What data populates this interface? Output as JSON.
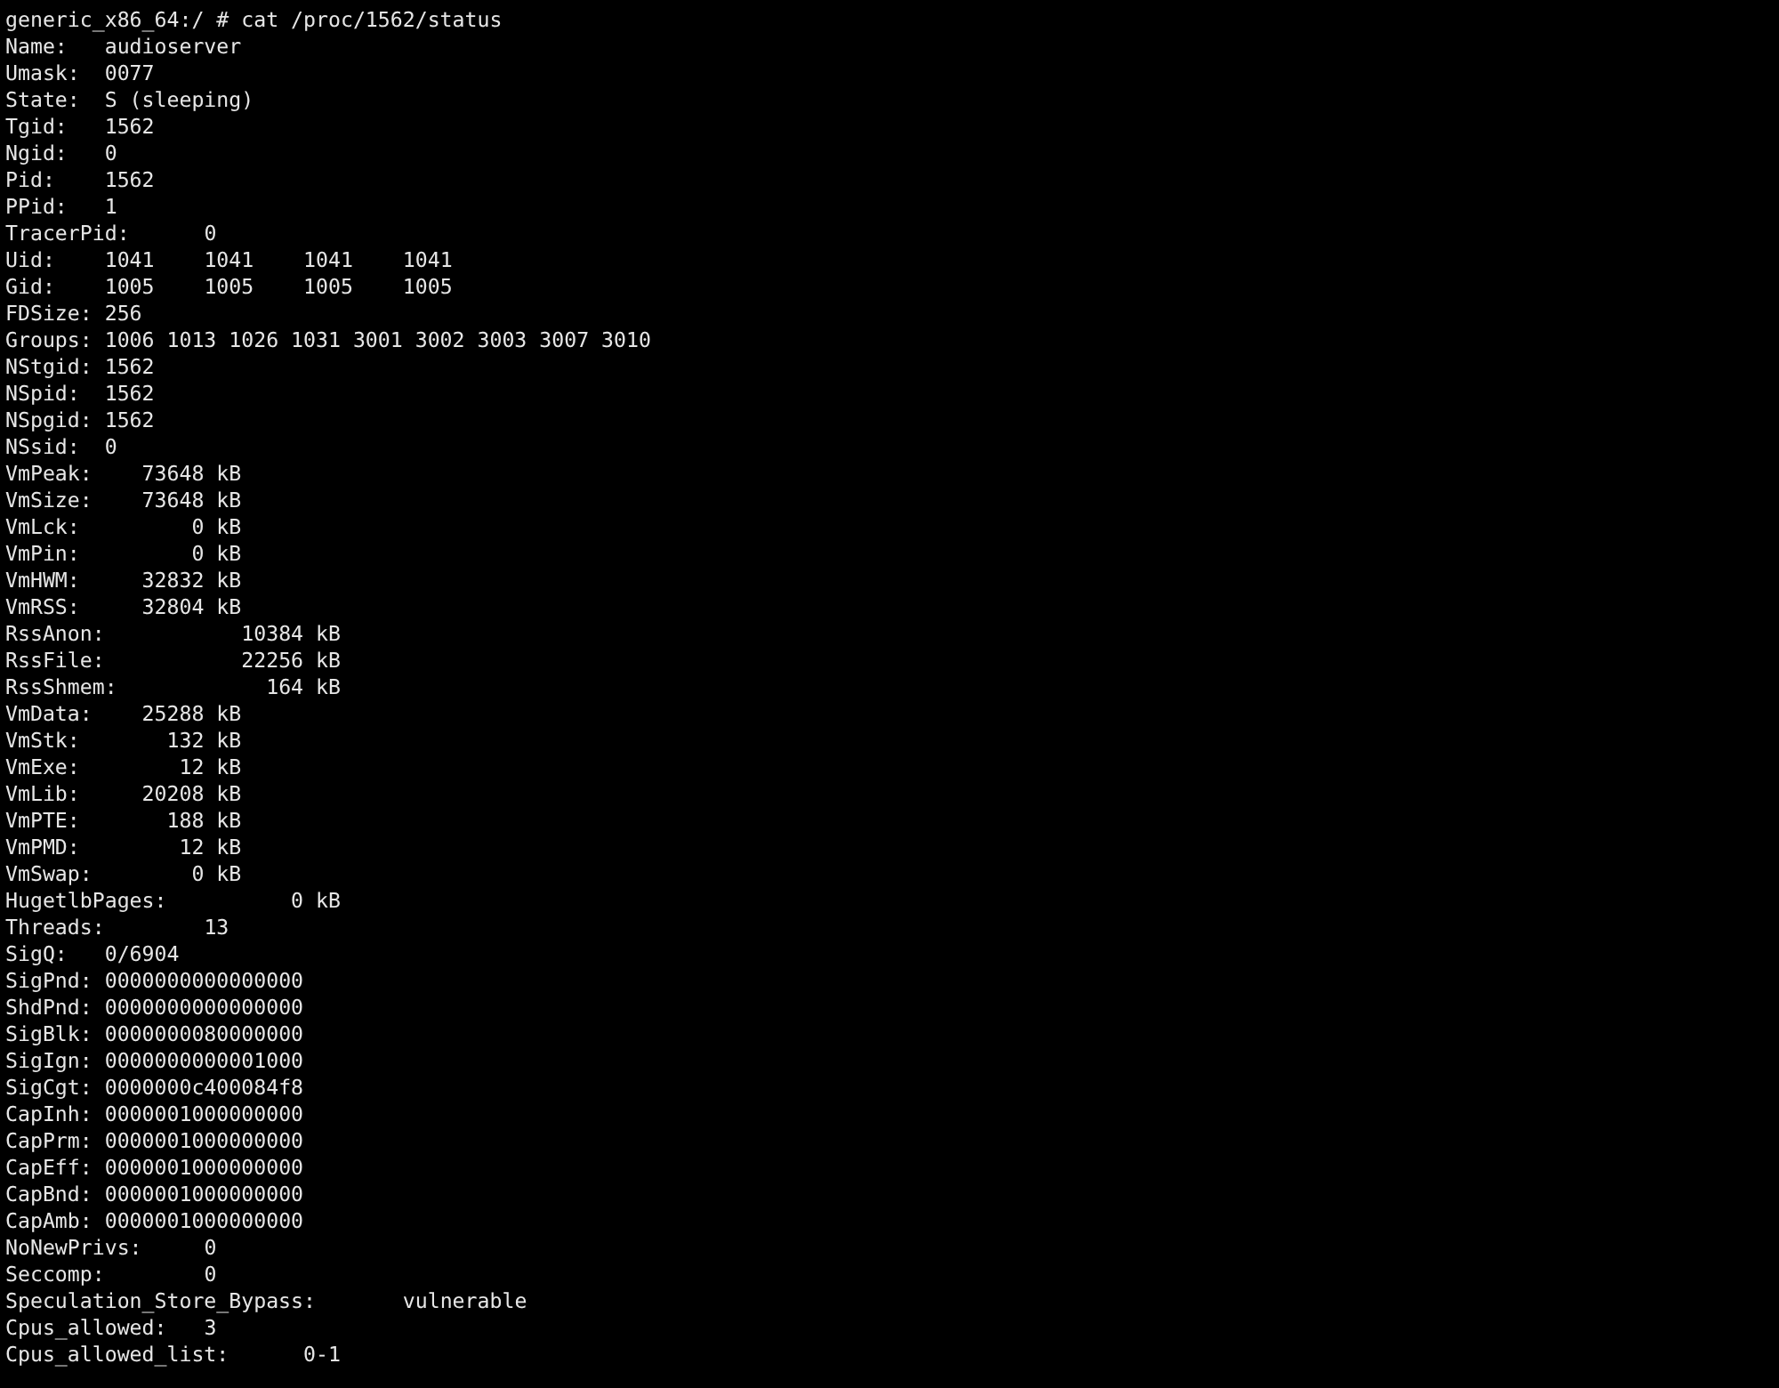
{
  "terminal": {
    "lines": [
      "generic_x86_64:/ # cat /proc/1562/status",
      "Name:\taudioserver",
      "Umask:\t0077",
      "State:\tS (sleeping)",
      "Tgid:\t1562",
      "Ngid:\t0",
      "Pid:\t1562",
      "PPid:\t1",
      "TracerPid:\t0",
      "Uid:\t1041\t1041\t1041\t1041",
      "Gid:\t1005\t1005\t1005\t1005",
      "FDSize:\t256",
      "Groups:\t1006 1013 1026 1031 3001 3002 3003 3007 3010",
      "NStgid:\t1562",
      "NSpid:\t1562",
      "NSpgid:\t1562",
      "NSsid:\t0",
      "VmPeak:\t   73648 kB",
      "VmSize:\t   73648 kB",
      "VmLck:\t       0 kB",
      "VmPin:\t       0 kB",
      "VmHWM:\t   32832 kB",
      "VmRSS:\t   32804 kB",
      "RssAnon:\t   10384 kB",
      "RssFile:\t   22256 kB",
      "RssShmem:\t     164 kB",
      "VmData:\t   25288 kB",
      "VmStk:\t     132 kB",
      "VmExe:\t      12 kB",
      "VmLib:\t   20208 kB",
      "VmPTE:\t     188 kB",
      "VmPMD:\t      12 kB",
      "VmSwap:\t       0 kB",
      "HugetlbPages:\t       0 kB",
      "Threads:\t13",
      "SigQ:\t0/6904",
      "SigPnd:\t0000000000000000",
      "ShdPnd:\t0000000000000000",
      "SigBlk:\t0000000080000000",
      "SigIgn:\t0000000000001000",
      "SigCgt:\t0000000c400084f8",
      "CapInh:\t0000001000000000",
      "CapPrm:\t0000001000000000",
      "CapEff:\t0000001000000000",
      "CapBnd:\t0000001000000000",
      "CapAmb:\t0000001000000000",
      "NoNewPrivs:\t0",
      "Seccomp:\t0",
      "Speculation_Store_Bypass:\tvulnerable",
      "Cpus_allowed:\t3",
      "Cpus_allowed_list:\t0-1"
    ]
  }
}
